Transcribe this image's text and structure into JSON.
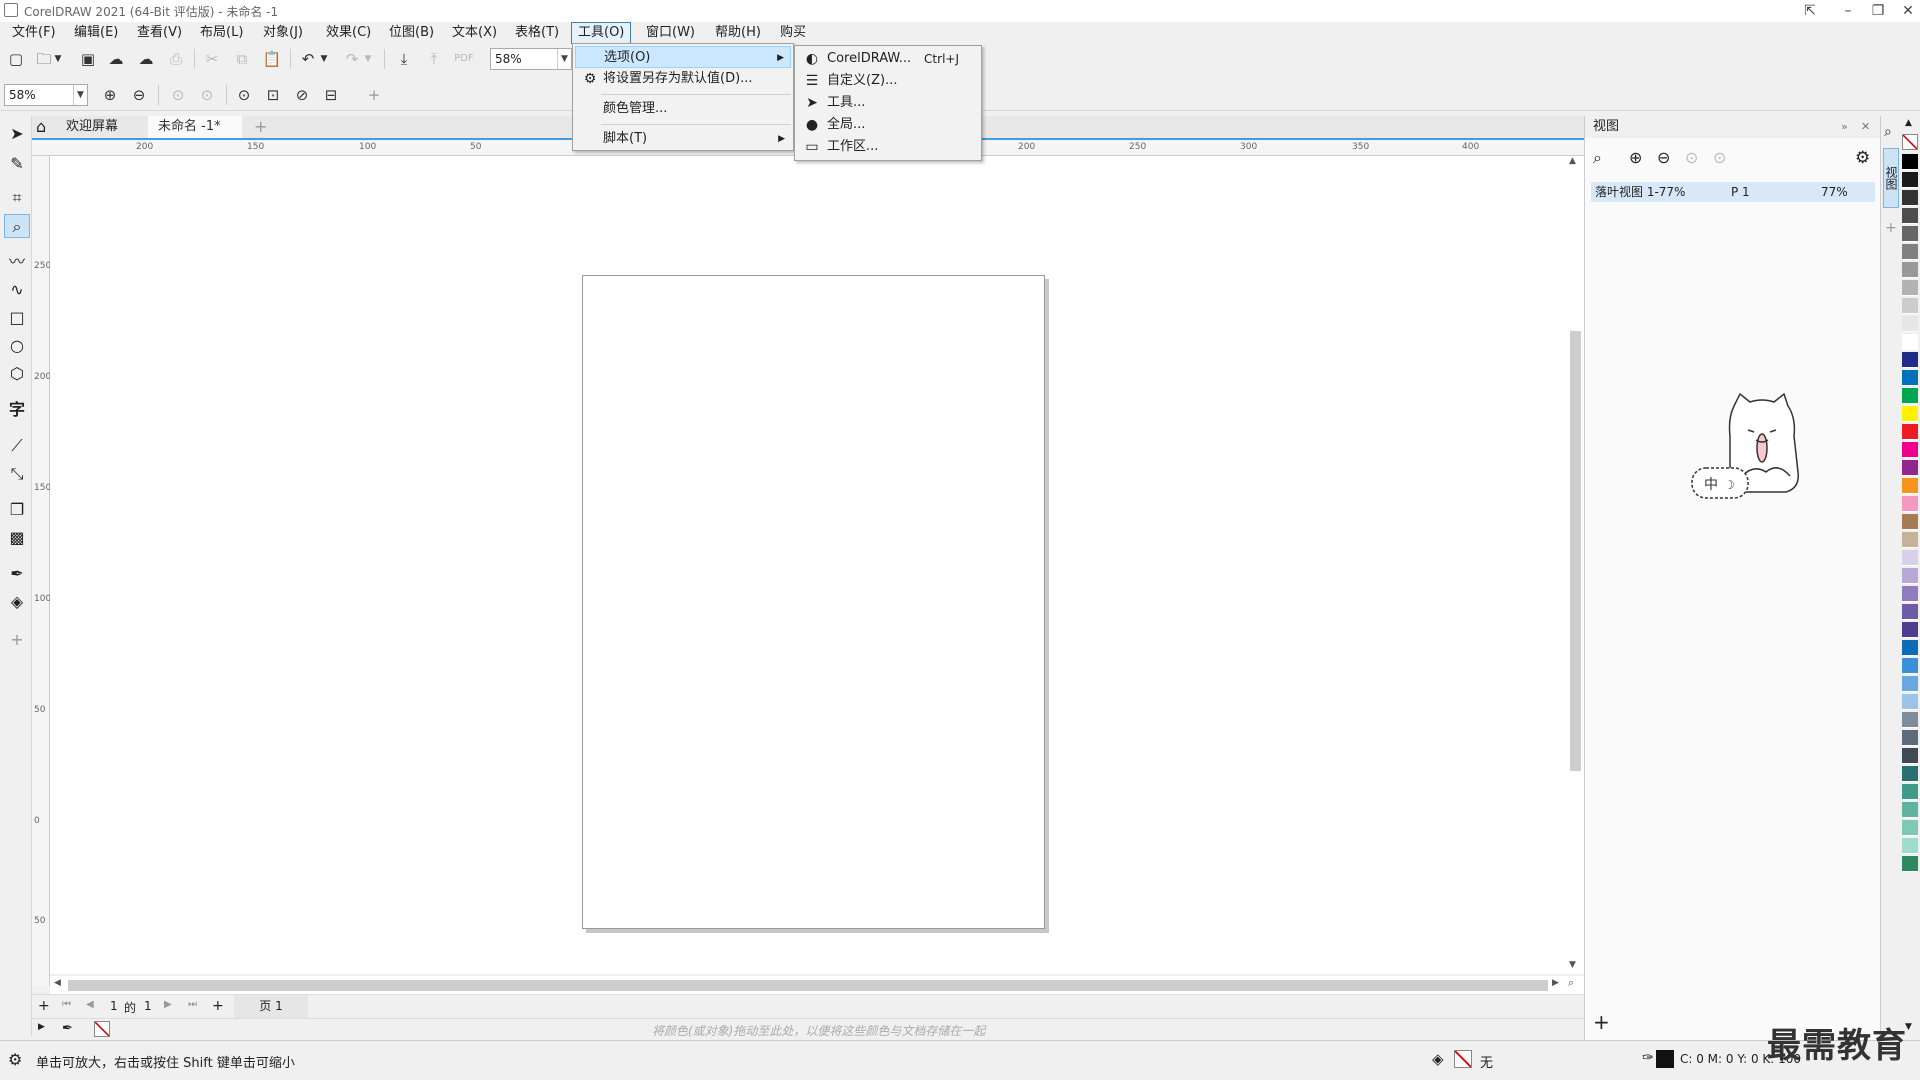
{
  "window": {
    "title": "CorelDRAW 2021 (64-Bit 评估版) - 未命名 -1",
    "minimize": "–",
    "restore": "❐",
    "close": "✕",
    "extra": "⇱"
  },
  "menubar": [
    "文件(F)",
    "编辑(E)",
    "查看(V)",
    "布局(L)",
    "对象(J)",
    "效果(C)",
    "位图(B)",
    "文本(X)",
    "表格(T)",
    "工具(O)",
    "窗口(W)",
    "帮助(H)",
    "购买"
  ],
  "toolbar": {
    "zoom_value": "58%",
    "zoom_value2": "58%"
  },
  "tools_menu": {
    "items": [
      {
        "label": "选项(O)",
        "has_submenu": true,
        "icon": "none"
      },
      {
        "label": "将设置另存为默认值(D)...",
        "has_submenu": false,
        "icon": "settings-save-icon"
      },
      {
        "label": "颜色管理...",
        "has_submenu": false,
        "icon": "none"
      },
      {
        "label": "脚本(T)",
        "has_submenu": true,
        "icon": "none"
      }
    ]
  },
  "options_submenu": {
    "items": [
      {
        "label": "CorelDRAW...",
        "shortcut": "Ctrl+J",
        "icon": "coreldraw-icon"
      },
      {
        "label": "自定义(Z)...",
        "shortcut": "",
        "icon": "customize-icon"
      },
      {
        "label": "工具...",
        "shortcut": "",
        "icon": "pointer-icon"
      },
      {
        "label": "全局...",
        "shortcut": "",
        "icon": "globe-pin-icon"
      },
      {
        "label": "工作区...",
        "shortcut": "",
        "icon": "workspace-monitor-icon"
      }
    ]
  },
  "doc_tabs": {
    "home": "⌂",
    "welcome": "欢迎屏幕",
    "doc": "未命名 -1*",
    "add": "+"
  },
  "hruler": {
    "labels": [
      "200",
      "150",
      "100",
      "50",
      "200",
      "250",
      "300",
      "350",
      "400"
    ]
  },
  "vruler": {
    "labels": [
      "250",
      "200",
      "150",
      "100",
      "50",
      "0",
      "50",
      "0"
    ]
  },
  "pagebar": {
    "add": "+",
    "current": "1",
    "of": "的",
    "total": "1",
    "page_tab": "页 1"
  },
  "palettebar": {
    "hint": "将颜色(或对象)拖动至此处，以便将这些颜色与文档存储在一起"
  },
  "statusbar": {
    "hint": "单击可放大，右击或按住 Shift 键单击可缩小",
    "fill_label": "无",
    "color_info": "C: 0 M: 0 Y: 0 K: 100"
  },
  "docker": {
    "title": "视图",
    "vertical_tab": "视图",
    "view_row": {
      "name": "落叶视图 1-77%",
      "page": "P 1",
      "zoom": "77%"
    },
    "mascot_text": "中",
    "add": "+"
  },
  "watermark": "最需教育",
  "palette_colors": [
    "#000000",
    "#1a1a1a",
    "#333333",
    "#4d4d4d",
    "#666666",
    "#808080",
    "#999999",
    "#b3b3b3",
    "#cccccc",
    "#e6e6e6",
    "#ffffff",
    "#1f2a8a",
    "#0072bc",
    "#00a651",
    "#fff200",
    "#ed1c24",
    "#ec008c",
    "#92278f",
    "#f7941d",
    "#f49ac1",
    "#a67c52",
    "#c7b299",
    "#d8d0e8",
    "#b7a8d8",
    "#8f7cc0",
    "#6d5ba8",
    "#4f3e90",
    "#0d6cb5",
    "#3b8ed8",
    "#6aa8e0",
    "#9cc4e8",
    "#7f8c99",
    "#5e6b78",
    "#3e4a56",
    "#2a6f6f",
    "#3f9a8a",
    "#5fb39f",
    "#7fc8b4",
    "#a0dccb",
    "#2c8a5e"
  ],
  "colors": {
    "accent": "#3aa0e0",
    "menu_highlight": "#cce8ff",
    "selection": "#cde4f7"
  }
}
